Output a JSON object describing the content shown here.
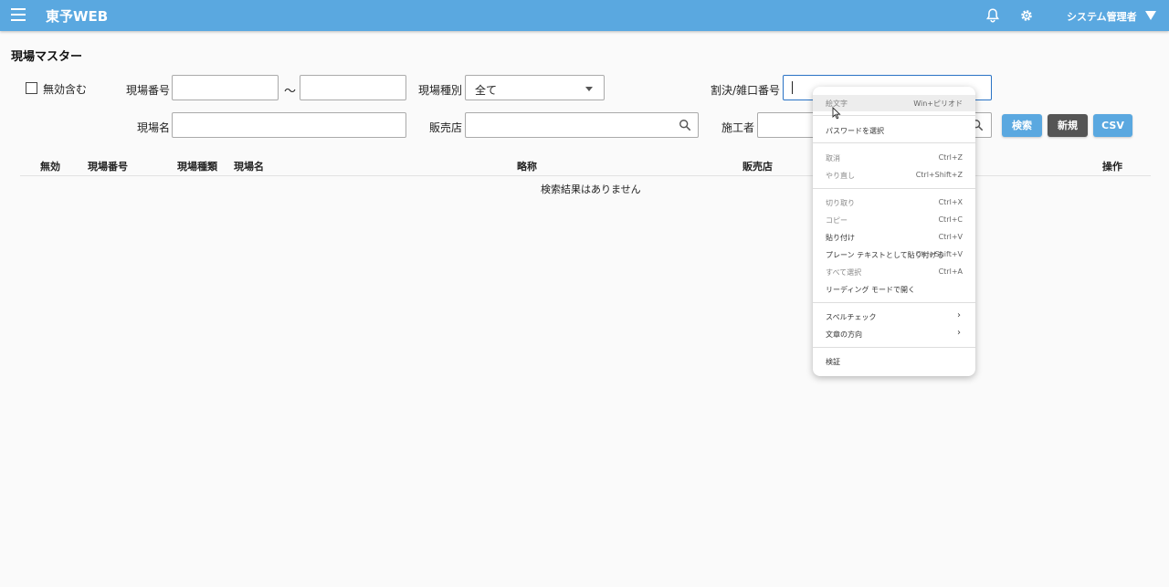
{
  "header": {
    "app_title": "東予WEB",
    "user_name": "システム管理者",
    "icons": [
      "menu-icon",
      "bell-icon",
      "gear-icon",
      "caret-down-icon"
    ],
    "color": "#5aa8e0"
  },
  "page": {
    "title": "現場マスター"
  },
  "filters": {
    "include_invalid_label": "無効含む",
    "site_number_label": "現場番号",
    "range_sep": "～",
    "site_type_label": "現場種別",
    "site_type_value": "全て",
    "split_number_label": "割決/雑口番号",
    "site_name_label": "現場名",
    "shop_label": "販売店",
    "builder_label": "施工者"
  },
  "buttons": {
    "search": "検索",
    "new": "新規",
    "csv": "CSV"
  },
  "table": {
    "headers": [
      "無効",
      "現場番号",
      "現場種類",
      "現場名",
      "略称",
      "販売店",
      "操作"
    ],
    "empty_message": "検索結果はありません"
  },
  "context_menu": {
    "items": [
      {
        "label": "絵文字",
        "shortcut": "Win+ピリオド",
        "enabled": false
      },
      {
        "label": "パスワードを選択",
        "shortcut": "",
        "enabled": true
      },
      {
        "label": "取消",
        "shortcut": "Ctrl+Z",
        "enabled": false
      },
      {
        "label": "やり直し",
        "shortcut": "Ctrl+Shift+Z",
        "enabled": false
      },
      {
        "label": "切り取り",
        "shortcut": "Ctrl+X",
        "enabled": false
      },
      {
        "label": "コピー",
        "shortcut": "Ctrl+C",
        "enabled": false
      },
      {
        "label": "貼り付け",
        "shortcut": "Ctrl+V",
        "enabled": true
      },
      {
        "label": "プレーン テキストとして貼り付ける",
        "shortcut": "Ctrl+Shift+V",
        "enabled": true
      },
      {
        "label": "すべて選択",
        "shortcut": "Ctrl+A",
        "enabled": false
      },
      {
        "label": "リーディング モードで開く",
        "shortcut": "",
        "enabled": true
      },
      {
        "label": "スペルチェック",
        "shortcut": "",
        "enabled": true
      },
      {
        "label": "文章の方向",
        "shortcut": "",
        "enabled": true
      },
      {
        "label": "検証",
        "shortcut": "",
        "enabled": true
      }
    ],
    "submenu_arrow": "›"
  }
}
